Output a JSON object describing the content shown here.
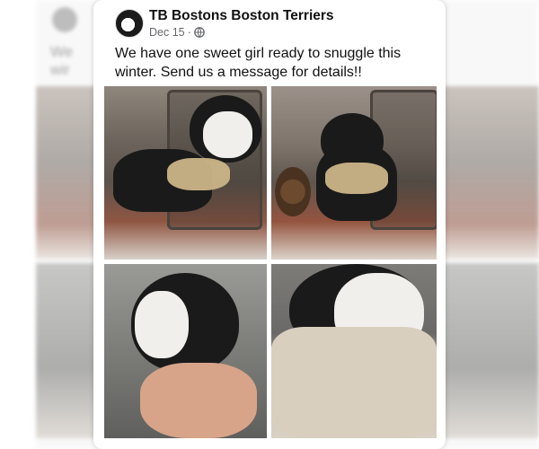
{
  "bg_left": {
    "text": "We\nwir"
  },
  "post": {
    "page_name": "TB Bostons Boston Terriers",
    "date": "Dec 15",
    "separator": "·",
    "audience_icon": "globe-icon",
    "text": "We have one sweet girl ready to snuggle this winter. Send us a message for details!!"
  },
  "photos": [
    {
      "name": "photo-puppy-lantern-front"
    },
    {
      "name": "photo-puppy-lantern-side"
    },
    {
      "name": "photo-puppy-held-in-hand"
    },
    {
      "name": "photo-puppy-on-blanket"
    }
  ]
}
